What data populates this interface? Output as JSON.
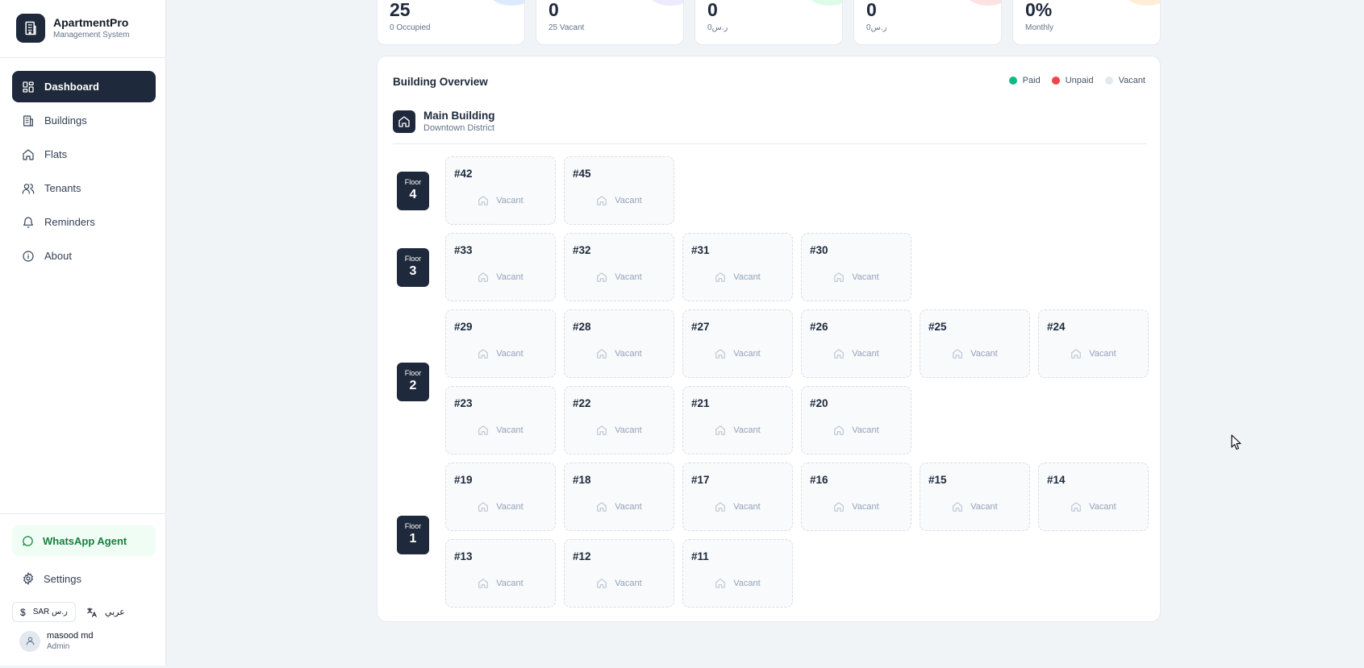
{
  "brand": {
    "name": "ApartmentPro",
    "subtitle": "Management System"
  },
  "nav": [
    {
      "label": "Dashboard",
      "icon": "dashboard-icon",
      "active": true
    },
    {
      "label": "Buildings",
      "icon": "building-icon"
    },
    {
      "label": "Flats",
      "icon": "home-icon"
    },
    {
      "label": "Tenants",
      "icon": "users-icon"
    },
    {
      "label": "Reminders",
      "icon": "bell-icon"
    },
    {
      "label": "About",
      "icon": "info-icon"
    }
  ],
  "sidebar_bottom": {
    "whatsapp": "WhatsApp Agent",
    "settings": "Settings",
    "currency": "SAR ر.س",
    "language": "عربي",
    "user_name": "masood md",
    "user_role": "Admin"
  },
  "stats": [
    {
      "value": "25",
      "sub": "0 Occupied",
      "color": "#dbeafe"
    },
    {
      "value": "0",
      "sub": "25 Vacant",
      "color": "#ede9fe"
    },
    {
      "value": "0",
      "sub": "0ر.س",
      "color": "#dcfce7"
    },
    {
      "value": "0",
      "sub": "0ر.س",
      "color": "#fee2e2"
    },
    {
      "value": "0%",
      "sub": "Monthly",
      "color": "#ffedd5"
    }
  ],
  "overview": {
    "title": "Building Overview",
    "legend": [
      {
        "label": "Paid",
        "color": "#10b981"
      },
      {
        "label": "Unpaid",
        "color": "#ef4444"
      },
      {
        "label": "Vacant",
        "color": "#e2e8f0"
      }
    ],
    "building": {
      "name": "Main Building",
      "location": "Downtown District"
    },
    "floor_label": "Floor",
    "floors": [
      {
        "number": "4",
        "units": [
          {
            "id": "#42",
            "status": "Vacant"
          },
          {
            "id": "#45",
            "status": "Vacant"
          }
        ]
      },
      {
        "number": "3",
        "units": [
          {
            "id": "#33",
            "status": "Vacant"
          },
          {
            "id": "#32",
            "status": "Vacant"
          },
          {
            "id": "#31",
            "status": "Vacant"
          },
          {
            "id": "#30",
            "status": "Vacant"
          }
        ]
      },
      {
        "number": "2",
        "units": [
          {
            "id": "#29",
            "status": "Vacant"
          },
          {
            "id": "#28",
            "status": "Vacant"
          },
          {
            "id": "#27",
            "status": "Vacant"
          },
          {
            "id": "#26",
            "status": "Vacant"
          },
          {
            "id": "#25",
            "status": "Vacant"
          },
          {
            "id": "#24",
            "status": "Vacant"
          },
          {
            "id": "#23",
            "status": "Vacant"
          },
          {
            "id": "#22",
            "status": "Vacant"
          },
          {
            "id": "#21",
            "status": "Vacant"
          },
          {
            "id": "#20",
            "status": "Vacant"
          }
        ]
      },
      {
        "number": "1",
        "units": [
          {
            "id": "#19",
            "status": "Vacant"
          },
          {
            "id": "#18",
            "status": "Vacant"
          },
          {
            "id": "#17",
            "status": "Vacant"
          },
          {
            "id": "#16",
            "status": "Vacant"
          },
          {
            "id": "#15",
            "status": "Vacant"
          },
          {
            "id": "#14",
            "status": "Vacant"
          },
          {
            "id": "#13",
            "status": "Vacant"
          },
          {
            "id": "#12",
            "status": "Vacant"
          },
          {
            "id": "#11",
            "status": "Vacant"
          }
        ]
      }
    ]
  }
}
